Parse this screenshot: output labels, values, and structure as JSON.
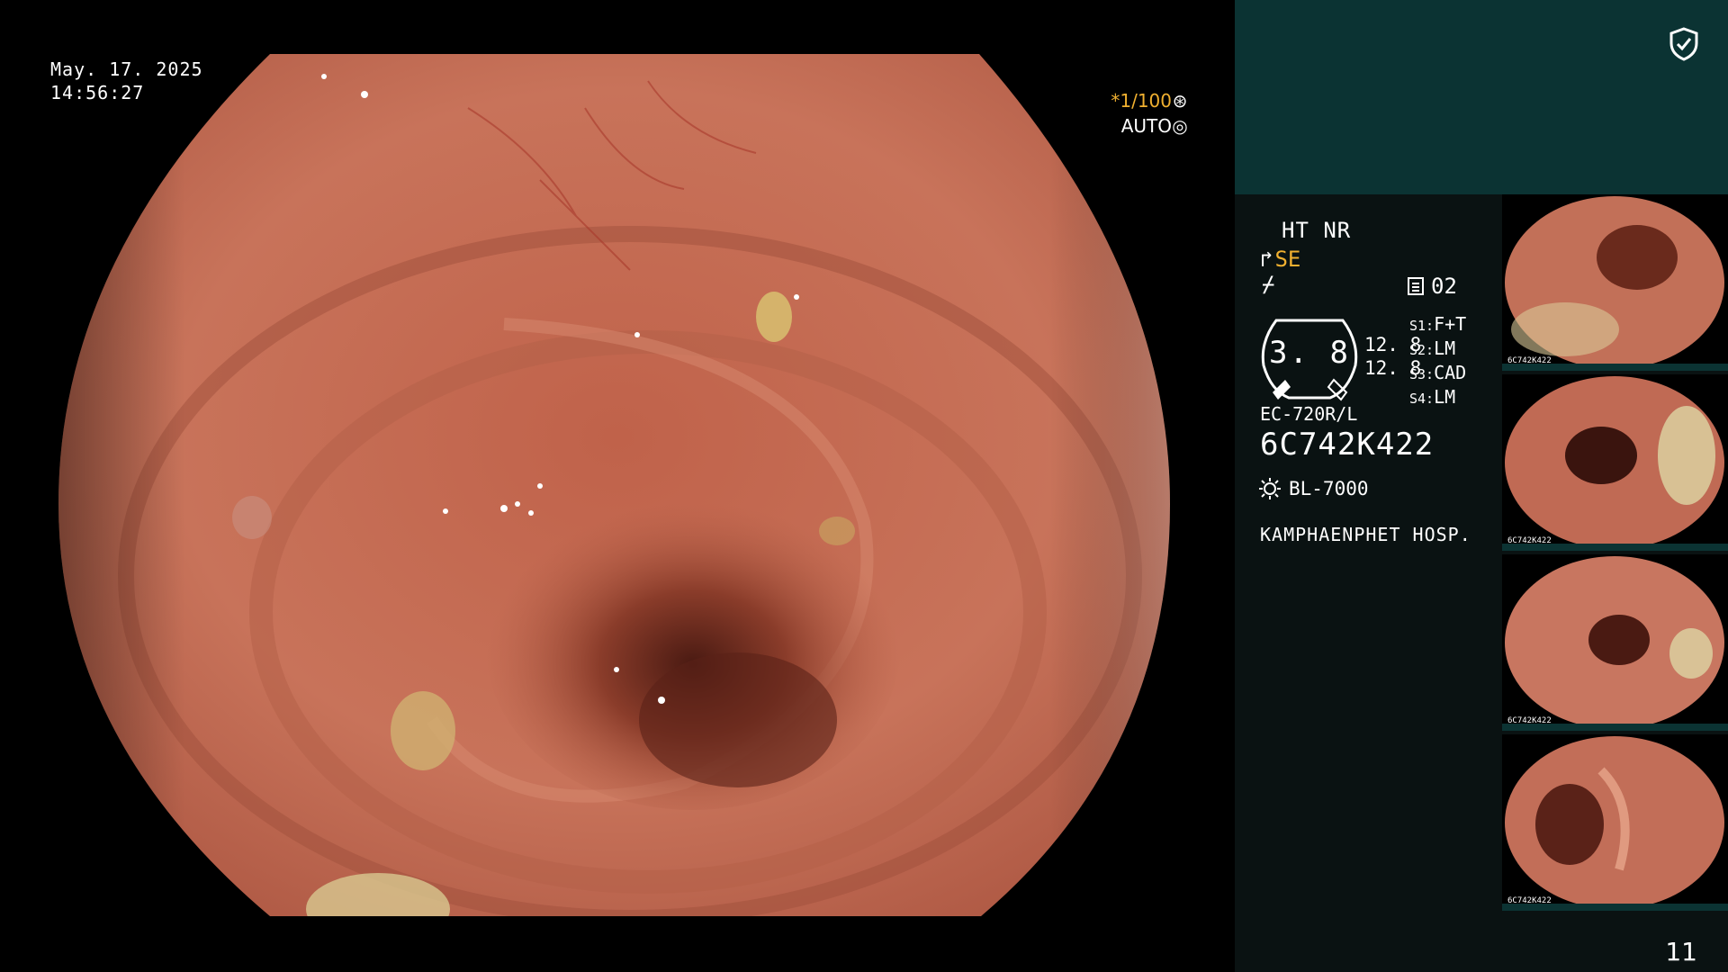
{
  "overlay": {
    "date": "May. 17. 2025",
    "time": "14:56:27",
    "shutter_speed": "*1/100",
    "iris_mode": "AUTO"
  },
  "panel": {
    "mode_line": "HT NR",
    "structure_enhancement": "SE",
    "memory_slot": "02",
    "brightness_value": "3. 8",
    "enhancement_values": [
      "12. 8",
      "12. 8"
    ],
    "slots": [
      {
        "key": "S1:",
        "value": "F+T"
      },
      {
        "key": "S2:",
        "value": "LM"
      },
      {
        "key": "S3:",
        "value": "CAD"
      },
      {
        "key": "S4:",
        "value": "LM"
      }
    ],
    "scope_model": "EC-720R/L",
    "scope_serial": "6C742K422",
    "light_source": "BL-7000",
    "hospital": "KAMPHAENPHET HOSP.",
    "thumbnail_caption": "6C742K422",
    "page_number": "11"
  },
  "colors": {
    "accent_orange": "#f0b030",
    "panel_header": "#0b3333",
    "panel_body": "#0a1212",
    "mucosa": "#c06a50"
  },
  "icons": [
    "shield-check-icon",
    "scope-tip-icon",
    "flash-icon",
    "memory-icon",
    "lamp-icon",
    "iris-icon",
    "shutter-icon"
  ]
}
